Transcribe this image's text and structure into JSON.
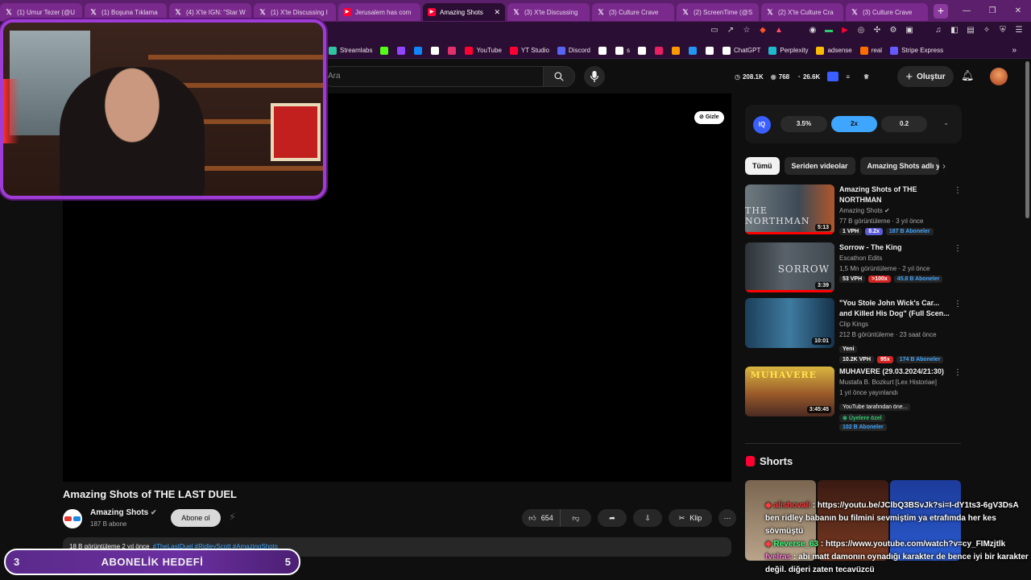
{
  "browser": {
    "tabs": [
      {
        "label": "(1) Umur Tezer (@U",
        "icon": "x-logo-icon",
        "active": false
      },
      {
        "label": "(1) Boşuna Tıklama",
        "icon": "x-logo-icon",
        "active": false
      },
      {
        "label": "(4) X'te IGN: \"Star W",
        "icon": "x-logo-icon",
        "active": false
      },
      {
        "label": "(1) X'te Discussing I",
        "icon": "x-logo-icon",
        "active": false
      },
      {
        "label": "Jerusalem has com",
        "icon": "youtube-icon",
        "active": false
      },
      {
        "label": "Amazing Shots",
        "icon": "youtube-icon",
        "active": true
      },
      {
        "label": "(3) X'te Discussing",
        "icon": "x-logo-icon",
        "active": false
      },
      {
        "label": "(3) Culture Crave",
        "icon": "x-logo-icon",
        "active": false
      },
      {
        "label": "(2) ScreenTime (@S",
        "icon": "x-logo-icon",
        "active": false
      },
      {
        "label": "(2) X'te Culture Cra",
        "icon": "x-logo-icon",
        "active": false
      },
      {
        "label": "(3) Culture Crave",
        "icon": "x-logo-icon",
        "active": false
      }
    ],
    "new_tab": "+",
    "bookmarks": [
      {
        "label": "Streamlabs",
        "color": "#31c3a2"
      },
      {
        "label": "",
        "color": "#53fc18"
      },
      {
        "label": "",
        "color": "#9146ff"
      },
      {
        "label": "",
        "color": "#1185fe"
      },
      {
        "label": "",
        "color": "#ffffff"
      },
      {
        "label": "",
        "color": "#e1306c"
      },
      {
        "label": "YouTube",
        "color": "#ff0033"
      },
      {
        "label": "YT Studio",
        "color": "#ff0033"
      },
      {
        "label": "Discord",
        "color": "#5865f2"
      },
      {
        "label": "",
        "color": "#ffffff"
      },
      {
        "label": "s",
        "color": "#ffffff"
      },
      {
        "label": "",
        "color": "#ffffff"
      },
      {
        "label": "",
        "color": "#e91e63"
      },
      {
        "label": "",
        "color": "#ff9800"
      },
      {
        "label": "",
        "color": "#2196f3"
      },
      {
        "label": "",
        "color": "#ffffff"
      },
      {
        "label": "ChatGPT",
        "color": "#ffffff"
      },
      {
        "label": "Perplexity",
        "color": "#20b8cd"
      },
      {
        "label": "adsense",
        "color": "#fbbc04"
      },
      {
        "label": "real",
        "color": "#ff6d00"
      },
      {
        "label": "Stripe Express",
        "color": "#635bff"
      }
    ]
  },
  "header": {
    "search_placeholder": "Ara",
    "stats": {
      "subs": "208.1K",
      "videos": "768",
      "views": "26.6K"
    },
    "create_label": "Oluştur"
  },
  "video": {
    "hide_label": "Gizle",
    "title": "Amazing Shots of THE LAST DUEL",
    "channel": "Amazing Shots",
    "subscribers": "187 B abone",
    "subscribe_label": "Abone ol",
    "likes": "654",
    "clip_label": "Klip",
    "description_meta": "18 B görüntüleme  2 yıl önce",
    "description_tags": "#TheLastDuel #RidleyScott #AmazingShots"
  },
  "panel": {
    "metrics": {
      "iq": "IQ",
      "a": "3.5%",
      "b": "2x",
      "c": "0.2"
    },
    "chips": [
      "Tümü",
      "Seriden videolar",
      "Amazing Shots adlı y"
    ],
    "recs": [
      {
        "title": "Amazing Shots of THE NORTHMAN",
        "channel": "Amazing Shots",
        "meta": "77 B görüntüleme · 3 yıl önce",
        "duration": "5:13",
        "thumb_text": "THE NORTHMAN",
        "badges": [
          {
            "t": "1 VPH",
            "k": ""
          },
          {
            "t": "8.2x",
            "k": "purple"
          },
          {
            "t": "187 B Aboneler",
            "k": "blue"
          }
        ],
        "extra": "",
        "progress": 1
      },
      {
        "title": "Sorrow - The King",
        "channel": "Escathon Edits",
        "meta": "1,5 Mn görüntüleme · 2 yıl önce",
        "duration": "3:39",
        "thumb_text": "SORROW",
        "badges": [
          {
            "t": "53 VPH",
            "k": ""
          },
          {
            "t": ">100x",
            "k": "red"
          },
          {
            "t": "45.8 B Aboneler",
            "k": "blue"
          }
        ],
        "extra": "",
        "progress": 1
      },
      {
        "title": "\"You Stole John Wick's Car... and Killed His Dog\" (Full Scen...",
        "channel": "Clip Kings",
        "meta": "212 B görüntüleme · 23 saat önce",
        "duration": "10:01",
        "thumb_text": "",
        "badges": [
          {
            "t": "10.2K VPH",
            "k": ""
          },
          {
            "t": "95x",
            "k": "red"
          },
          {
            "t": "174 B Aboneler",
            "k": "blue"
          }
        ],
        "extra": "Yeni",
        "progress": 0
      },
      {
        "title": "MUHAVERE (29.03.2024/21:30)",
        "channel": "Mustafa B. Bozkurt [Lex Historiae]",
        "meta": "1 yıl önce yayınlandı",
        "duration": "3:45:45",
        "thumb_text": "MUHAVERE",
        "badges": [
          {
            "t": "102 B Aboneler",
            "k": "blue"
          }
        ],
        "extra": "YouTube tarafından öne...",
        "members": "Üyelere özel",
        "progress": 0
      }
    ],
    "shorts_title": "Shorts"
  },
  "chat": [
    {
      "user": "alishovali",
      "color": "red",
      "text": ": https://youtu.be/JClbQ3BSvJk?si=I-dY1ts3-6gV3DsA ben ridley babanın bu filmini sevmiştim ya etrafımda her kes sövmüştü"
    },
    {
      "user": "Reverse_63",
      "color": "green",
      "text": ": https://www.youtube.com/watch?v=cy_FIMzjtlk"
    },
    {
      "user": "fvelras",
      "color": "pink",
      "text": ": abi matt damonın oynadığı karakter de bence iyi bir karakter değil. diğeri zaten tecavüzcü"
    }
  ],
  "goal": {
    "current": "3",
    "label": "ABONELİK HEDEFİ",
    "target": "5"
  }
}
